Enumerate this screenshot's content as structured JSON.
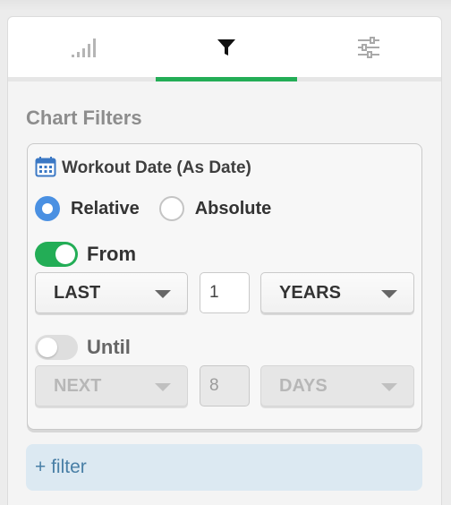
{
  "tabs": [
    {
      "icon": "bar-signal-icon",
      "active": false
    },
    {
      "icon": "filter-icon",
      "active": true
    },
    {
      "icon": "sliders-icon",
      "active": false
    }
  ],
  "accent_color": "#23ad56",
  "section_title": "Chart Filters",
  "filter": {
    "icon": "calendar-icon",
    "field_label": "Workout Date (As Date)",
    "mode": {
      "relative_label": "Relative",
      "absolute_label": "Absolute",
      "selected": "Relative"
    },
    "from": {
      "label": "From",
      "enabled": true,
      "direction": "LAST",
      "amount": "1",
      "unit": "YEARS"
    },
    "until": {
      "label": "Until",
      "enabled": false,
      "direction": "NEXT",
      "amount": "8",
      "unit": "DAYS"
    }
  },
  "add_filter_label": "+ filter"
}
